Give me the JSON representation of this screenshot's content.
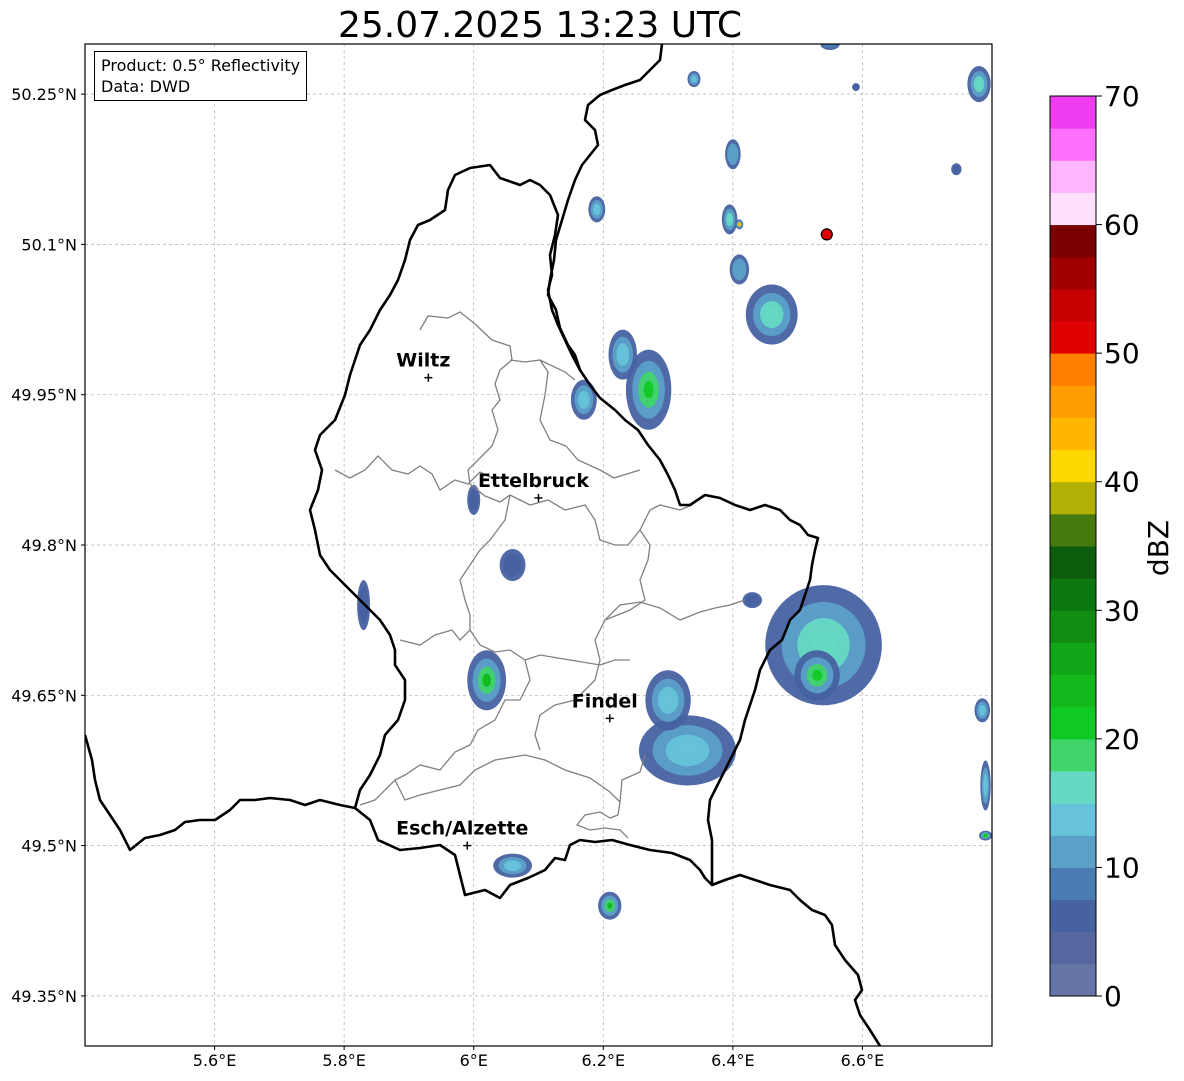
{
  "title": "25.07.2025 13:23 UTC",
  "info": {
    "product_line": "Product: 0.5° Reflectivity",
    "data_line": "Data: DWD"
  },
  "axes": {
    "lon_ticks": [
      {
        "value": 5.6,
        "label": "5.6°E"
      },
      {
        "value": 5.8,
        "label": "5.8°E"
      },
      {
        "value": 6.0,
        "label": "6°E"
      },
      {
        "value": 6.2,
        "label": "6.2°E"
      },
      {
        "value": 6.4,
        "label": "6.4°E"
      },
      {
        "value": 6.6,
        "label": "6.6°E"
      }
    ],
    "lat_ticks": [
      {
        "value": 50.25,
        "label": "50.25°N"
      },
      {
        "value": 50.1,
        "label": "50.1°N"
      },
      {
        "value": 49.95,
        "label": "49.95°N"
      },
      {
        "value": 49.8,
        "label": "49.8°N"
      },
      {
        "value": 49.65,
        "label": "49.65°N"
      },
      {
        "value": 49.5,
        "label": "49.5°N"
      },
      {
        "value": 49.35,
        "label": "49.35°N"
      }
    ],
    "lon_range": [
      5.4,
      6.8
    ],
    "lat_range": [
      49.3,
      50.3
    ],
    "grid": true
  },
  "cities": [
    {
      "name": "Wiltz",
      "lon": 5.93,
      "lat": 49.967
    },
    {
      "name": "Ettelbruck",
      "lon": 6.1,
      "lat": 49.847
    },
    {
      "name": "Findel",
      "lon": 6.21,
      "lat": 49.627
    },
    {
      "name": "Esch/Alzette",
      "lon": 5.99,
      "lat": 49.5
    }
  ],
  "marker": {
    "lon": 6.545,
    "lat": 50.11,
    "color": "#dd0000"
  },
  "colorbar": {
    "label": "dBZ",
    "min": 0,
    "max": 70,
    "tick_labels": [
      "0",
      "10",
      "20",
      "30",
      "40",
      "50",
      "60",
      "70"
    ],
    "colors": [
      "#6675a8",
      "#56679f",
      "#4762a2",
      "#4a7cb4",
      "#5ba0c8",
      "#66c3db",
      "#66d9c3",
      "#40d46b",
      "#11c924",
      "#12b81c",
      "#12a517",
      "#128c12",
      "#0c770f",
      "#0b5c0c",
      "#467a0e",
      "#b0b005",
      "#ffd700",
      "#ffb700",
      "#ff9e00",
      "#ff7f00",
      "#e10000",
      "#c40000",
      "#a10000",
      "#7a0000",
      "#ffe0ff",
      "#ffb5ff",
      "#ff70ff",
      "#ee3df0"
    ]
  },
  "echoes": [
    {
      "lon": 6.27,
      "lat": 49.955,
      "rx": 0.035,
      "ry": 0.04,
      "dbz": 22
    },
    {
      "lon": 6.23,
      "lat": 49.99,
      "rx": 0.022,
      "ry": 0.025,
      "dbz": 14
    },
    {
      "lon": 6.54,
      "lat": 49.7,
      "rx": 0.09,
      "ry": 0.06,
      "dbz": 16
    },
    {
      "lon": 6.53,
      "lat": 49.67,
      "rx": 0.035,
      "ry": 0.025,
      "dbz": 22
    },
    {
      "lon": 6.33,
      "lat": 49.595,
      "rx": 0.075,
      "ry": 0.035,
      "dbz": 13
    },
    {
      "lon": 6.3,
      "lat": 49.645,
      "rx": 0.035,
      "ry": 0.03,
      "dbz": 14
    },
    {
      "lon": 6.02,
      "lat": 49.665,
      "rx": 0.03,
      "ry": 0.03,
      "dbz": 24
    },
    {
      "lon": 6.46,
      "lat": 50.03,
      "rx": 0.04,
      "ry": 0.03,
      "dbz": 16
    },
    {
      "lon": 6.06,
      "lat": 49.48,
      "rx": 0.03,
      "ry": 0.012,
      "dbz": 14
    },
    {
      "lon": 6.21,
      "lat": 49.44,
      "rx": 0.018,
      "ry": 0.014,
      "dbz": 24
    },
    {
      "lon": 6.06,
      "lat": 49.78,
      "rx": 0.02,
      "ry": 0.016,
      "dbz": 7
    },
    {
      "lon": 6.0,
      "lat": 49.845,
      "rx": 0.01,
      "ry": 0.015,
      "dbz": 6
    },
    {
      "lon": 5.83,
      "lat": 49.74,
      "rx": 0.01,
      "ry": 0.025,
      "dbz": 6
    },
    {
      "lon": 6.19,
      "lat": 50.135,
      "rx": 0.013,
      "ry": 0.013,
      "dbz": 14
    },
    {
      "lon": 6.4,
      "lat": 50.19,
      "rx": 0.012,
      "ry": 0.015,
      "dbz": 12
    },
    {
      "lon": 6.395,
      "lat": 50.125,
      "rx": 0.012,
      "ry": 0.015,
      "dbz": 16
    },
    {
      "lon": 6.41,
      "lat": 50.12,
      "rx": 0.006,
      "ry": 0.005,
      "dbz": 43
    },
    {
      "lon": 6.41,
      "lat": 50.075,
      "rx": 0.015,
      "ry": 0.015,
      "dbz": 12
    },
    {
      "lon": 6.34,
      "lat": 50.265,
      "rx": 0.01,
      "ry": 0.008,
      "dbz": 14
    },
    {
      "lon": 6.55,
      "lat": 50.3,
      "rx": 0.015,
      "ry": 0.006,
      "dbz": 8
    },
    {
      "lon": 6.78,
      "lat": 50.26,
      "rx": 0.018,
      "ry": 0.018,
      "dbz": 16
    },
    {
      "lon": 6.745,
      "lat": 50.175,
      "rx": 0.008,
      "ry": 0.006,
      "dbz": 6
    },
    {
      "lon": 6.59,
      "lat": 50.257,
      "rx": 0.006,
      "ry": 0.004,
      "dbz": 6
    },
    {
      "lon": 6.785,
      "lat": 49.635,
      "rx": 0.012,
      "ry": 0.012,
      "dbz": 14
    },
    {
      "lon": 6.79,
      "lat": 49.56,
      "rx": 0.008,
      "ry": 0.025,
      "dbz": 13
    },
    {
      "lon": 6.79,
      "lat": 49.51,
      "rx": 0.01,
      "ry": 0.005,
      "dbz": 20
    },
    {
      "lon": 6.17,
      "lat": 49.945,
      "rx": 0.02,
      "ry": 0.02,
      "dbz": 13
    },
    {
      "lon": 6.43,
      "lat": 49.745,
      "rx": 0.015,
      "ry": 0.008,
      "dbz": 6
    }
  ]
}
